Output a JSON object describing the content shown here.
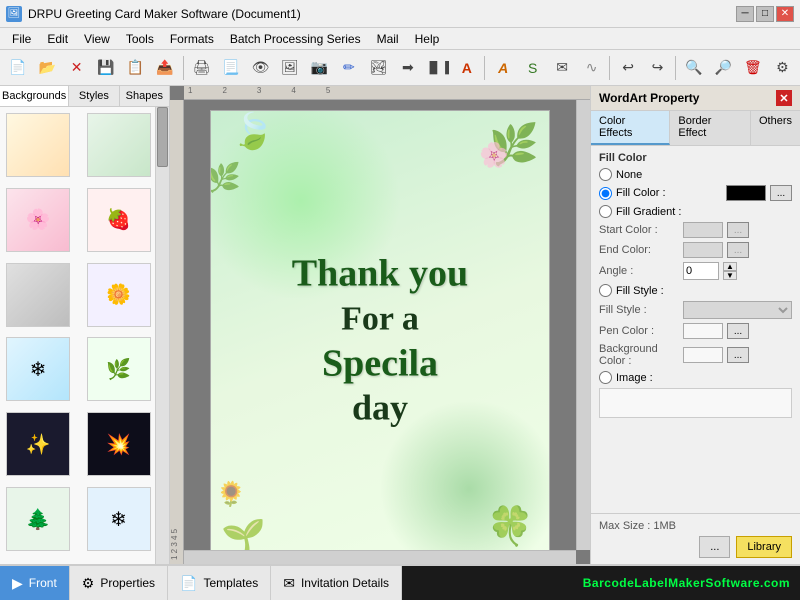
{
  "titlebar": {
    "icon": "🖼",
    "title": "DRPU Greeting Card Maker Software (Document1)",
    "min_btn": "─",
    "max_btn": "□",
    "close_btn": "✕"
  },
  "menubar": {
    "items": [
      "File",
      "Edit",
      "View",
      "Tools",
      "Formats",
      "Batch Processing Series",
      "Mail",
      "Help"
    ]
  },
  "left_panel": {
    "tabs": [
      "Backgrounds",
      "Styles",
      "Shapes"
    ]
  },
  "canvas": {
    "card_text": {
      "line1": "Thank you",
      "line2": "For a",
      "line3": "Specila",
      "line4": "day"
    }
  },
  "right_panel": {
    "title": "WordArt Property",
    "close_btn": "✕",
    "tabs": [
      "Color Effects",
      "Border Effect",
      "Others"
    ],
    "active_tab": "Color Effects",
    "fill_color_section": "Fill Color",
    "none_label": "None",
    "fill_color_label": "Fill Color :",
    "fill_gradient_label": "Fill Gradient :",
    "start_color_label": "Start Color :",
    "end_color_label": "End Color:",
    "angle_label": "Angle :",
    "angle_value": "0",
    "fill_style_label1": "Fill Style :",
    "fill_style_label2": "Fill Style :",
    "pen_color_label": "Pen Color :",
    "bg_color_label": "Background Color :",
    "image_label": "Image :",
    "max_size": "Max Size : 1MB",
    "lib_btn": "Library",
    "dots_btn": "..."
  },
  "bottom_bar": {
    "tabs": [
      {
        "icon": "▶",
        "label": "Front"
      },
      {
        "icon": "⚙",
        "label": "Properties"
      },
      {
        "icon": "📄",
        "label": "Templates"
      },
      {
        "icon": "✉",
        "label": "Invitation Details"
      }
    ],
    "brand": "BarcodeLabelMakerSoftware.com"
  }
}
